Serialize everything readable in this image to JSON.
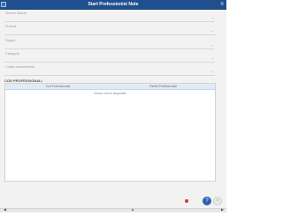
{
  "window": {
    "title": "Start Professionist Note"
  },
  "fields": [
    {
      "label": "Service Source"
    },
    {
      "label": "Product"
    },
    {
      "label": "Region"
    },
    {
      "label": "Categoria"
    },
    {
      "label": "Codice Assortimento"
    }
  ],
  "section": {
    "title": "COD PROFESSIONALI"
  },
  "table": {
    "columns": [
      "Cod Professionale",
      "Partita Professionale"
    ],
    "empty_text": "Nessun record disponibile"
  },
  "actions": {
    "primary_icon": "?",
    "secondary_icon": "×"
  },
  "icons": [
    "close-icon",
    "menu-icon",
    "chevron-down-icon",
    "warning-dot-icon",
    "flag-icon",
    "help-icon",
    "cancel-icon"
  ],
  "colors": {
    "accent": "#2b63b3",
    "title_bar": "#1f4f8f",
    "header_bg": "#e1ebf7"
  },
  "statusbar": {
    "left": "◀",
    "mid": "▲",
    "right": "▶"
  }
}
